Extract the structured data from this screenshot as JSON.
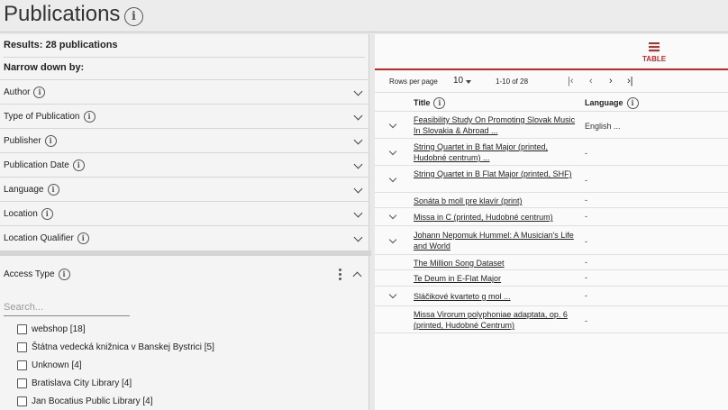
{
  "page": {
    "title": "Publications"
  },
  "filters": {
    "results": "Results: 28 publications",
    "narrow": "Narrow down by:",
    "items": [
      "Author",
      "Type of Publication",
      "Publisher",
      "Publication Date",
      "Language",
      "Location",
      "Location Qualifier"
    ]
  },
  "access": {
    "title": "Access Type",
    "search_placeholder": "Search...",
    "options": [
      "webshop [18]",
      "Štátna vedecká knižnica v Banskej Bystrici [5]",
      "Unknown [4]",
      "Bratislava City Library [4]",
      "Jan Bocatius Public Library [4]"
    ]
  },
  "view": {
    "tab_label": "TABLE"
  },
  "pager": {
    "rows_label": "Rows per page",
    "rows_value": "10",
    "range": "1-10 of 28"
  },
  "table": {
    "col_title": "Title",
    "col_language": "Language",
    "rows": [
      {
        "title": "Feasibility Study On Promoting Slovak Music In Slovakia & Abroad ...",
        "language": "English ..."
      },
      {
        "title": "String Quartet in B flat Major (printed, Hudobné centrum) ...",
        "language": "-"
      },
      {
        "title": "String Quartet in B Flat Major (printed, SHF)",
        "language": "-"
      },
      {
        "title": "Sonáta b moll pre klavír (print)",
        "language": "-"
      },
      {
        "title": "Missa in C (printed, Hudobné centrum)",
        "language": "-"
      },
      {
        "title": "Johann Nepomuk Hummel: A Musician's Life and World",
        "language": "-"
      },
      {
        "title": "The Million Song Dataset",
        "language": "-"
      },
      {
        "title": "Te Deum in E-Flat Major",
        "language": "-"
      },
      {
        "title": "Sláčikové kvarteto g mol ...",
        "language": "-"
      },
      {
        "title": "Missa Virorum polyphoniae adaptata, op. 6 (printed, Hudobné Centrum)",
        "language": "-"
      }
    ]
  }
}
